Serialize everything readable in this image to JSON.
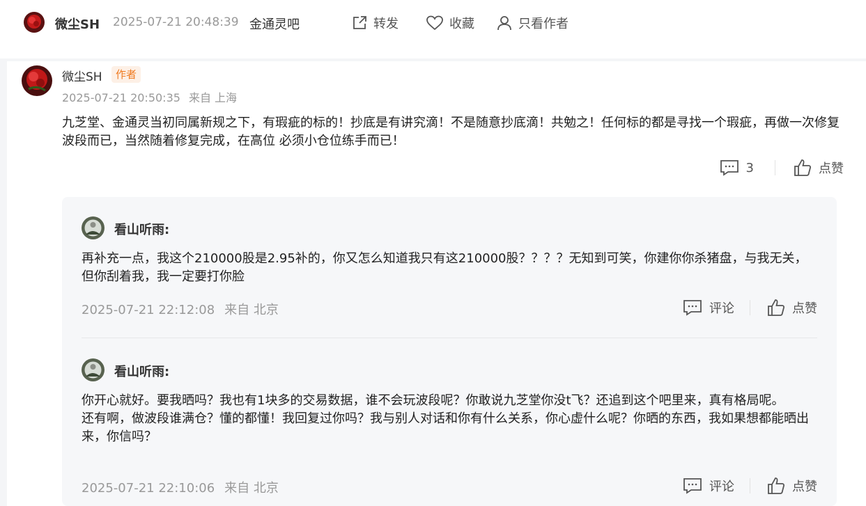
{
  "header": {
    "username": "微尘SH",
    "timestamp": "2025-07-21 20:48:39",
    "bar_name": "金通灵吧",
    "forward_label": "转发",
    "favorite_label": "收藏",
    "author_only_label": "只看作者"
  },
  "comment": {
    "username": "微尘SH",
    "badge": "作者",
    "timestamp": "2025-07-21 20:50:35",
    "location": "来自 上海",
    "text": "九芝堂、金通灵当初同属新规之下，有瑕疵的标的！抄底是有讲究滴！不是随意抄底滴！共勉之！任何标的都是寻找一个瑕疵，再做一次修复波段而已，当然随着修复完成，在高位 必须小仓位练手而已！",
    "reply_count": "3",
    "like_label": "点赞"
  },
  "replies": [
    {
      "username": "看山听雨:",
      "text": "再补充一点，我这个210000股是2.95补的，你又怎么知道我只有这210000股？？？？无知到可笑，你建你你杀猪盘，与我无关，但你刮着我，我一定要打你脸",
      "timestamp": "2025-07-21 22:12:08",
      "location": "来自 北京",
      "comment_label": "评论",
      "like_label": "点赞"
    },
    {
      "username": "看山听雨:",
      "text_line1": "你开心就好。要我晒吗？我也有1块多的交易数据，谁不会玩波段呢？你敢说九芝堂你没t飞？还追到这个吧里来，真有格局呢。",
      "text_line2": "还有啊，做波段谁满仓？懂的都懂！我回复过你吗？我与别人对话和你有什么关系，你心虚什么呢？你晒的东西，我如果想都能晒出来，你信吗？",
      "timestamp": "2025-07-21 22:10:06",
      "location": "来自 北京",
      "comment_label": "评论",
      "like_label": "点赞"
    }
  ]
}
